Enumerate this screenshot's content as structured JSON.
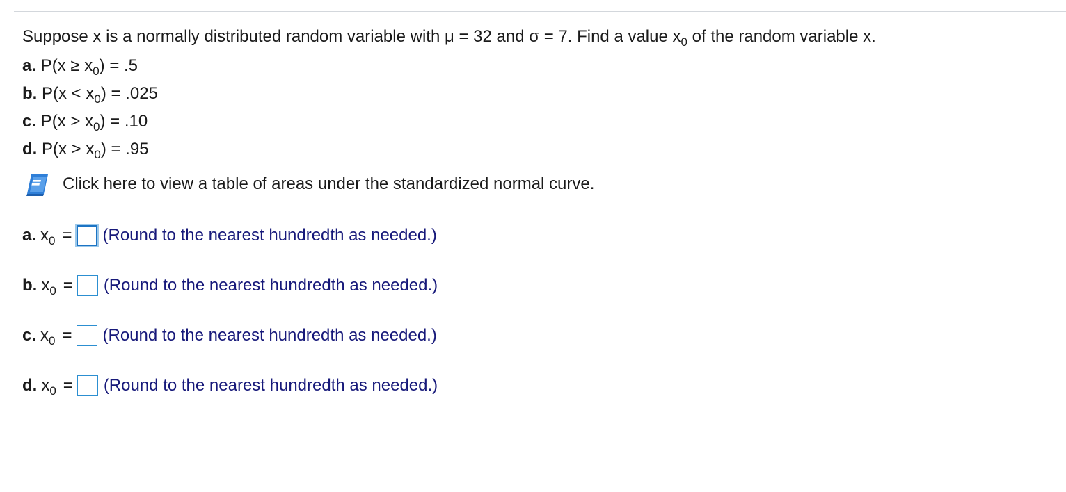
{
  "question": {
    "text_prefix": "Suppose x is a normally distributed random variable with ",
    "mu_symbol": "μ",
    "mu_eq": " = 32 and ",
    "sigma_symbol": "σ",
    "sigma_eq": " = 7. Find a value x",
    "sub0": "0",
    "suffix": " of the random variable x."
  },
  "parts": [
    {
      "label": "a.",
      "pre": " P(x ≥ x",
      "sub": "0",
      "post": ") = .5"
    },
    {
      "label": "b.",
      "pre": " P(x < x",
      "sub": "0",
      "post": ") = .025"
    },
    {
      "label": "c.",
      "pre": " P(x > x",
      "sub": "0",
      "post": ") = .10"
    },
    {
      "label": "d.",
      "pre": " P(x > x",
      "sub": "0",
      "post": ") = .95"
    }
  ],
  "table_link": {
    "icon": "book-icon",
    "text": "Click here to view a table of areas under the standardized normal curve."
  },
  "answers": [
    {
      "label": "a.",
      "var": "x",
      "sub": "0",
      "eq": "=",
      "value": "",
      "hint": "(Round to the nearest hundredth as needed.)"
    },
    {
      "label": "b.",
      "var": "x",
      "sub": "0",
      "eq": "=",
      "value": "",
      "hint": "(Round to the nearest hundredth as needed.)"
    },
    {
      "label": "c.",
      "var": "x",
      "sub": "0",
      "eq": "=",
      "value": "",
      "hint": "(Round to the nearest hundredth as needed.)"
    },
    {
      "label": "d.",
      "var": "x",
      "sub": "0",
      "eq": "=",
      "value": "",
      "hint": "(Round to the nearest hundredth as needed.)"
    }
  ],
  "colors": {
    "hint_text": "#17197a",
    "input_border": "#2c8fd1",
    "icon_blue": "#2f7fd8"
  }
}
